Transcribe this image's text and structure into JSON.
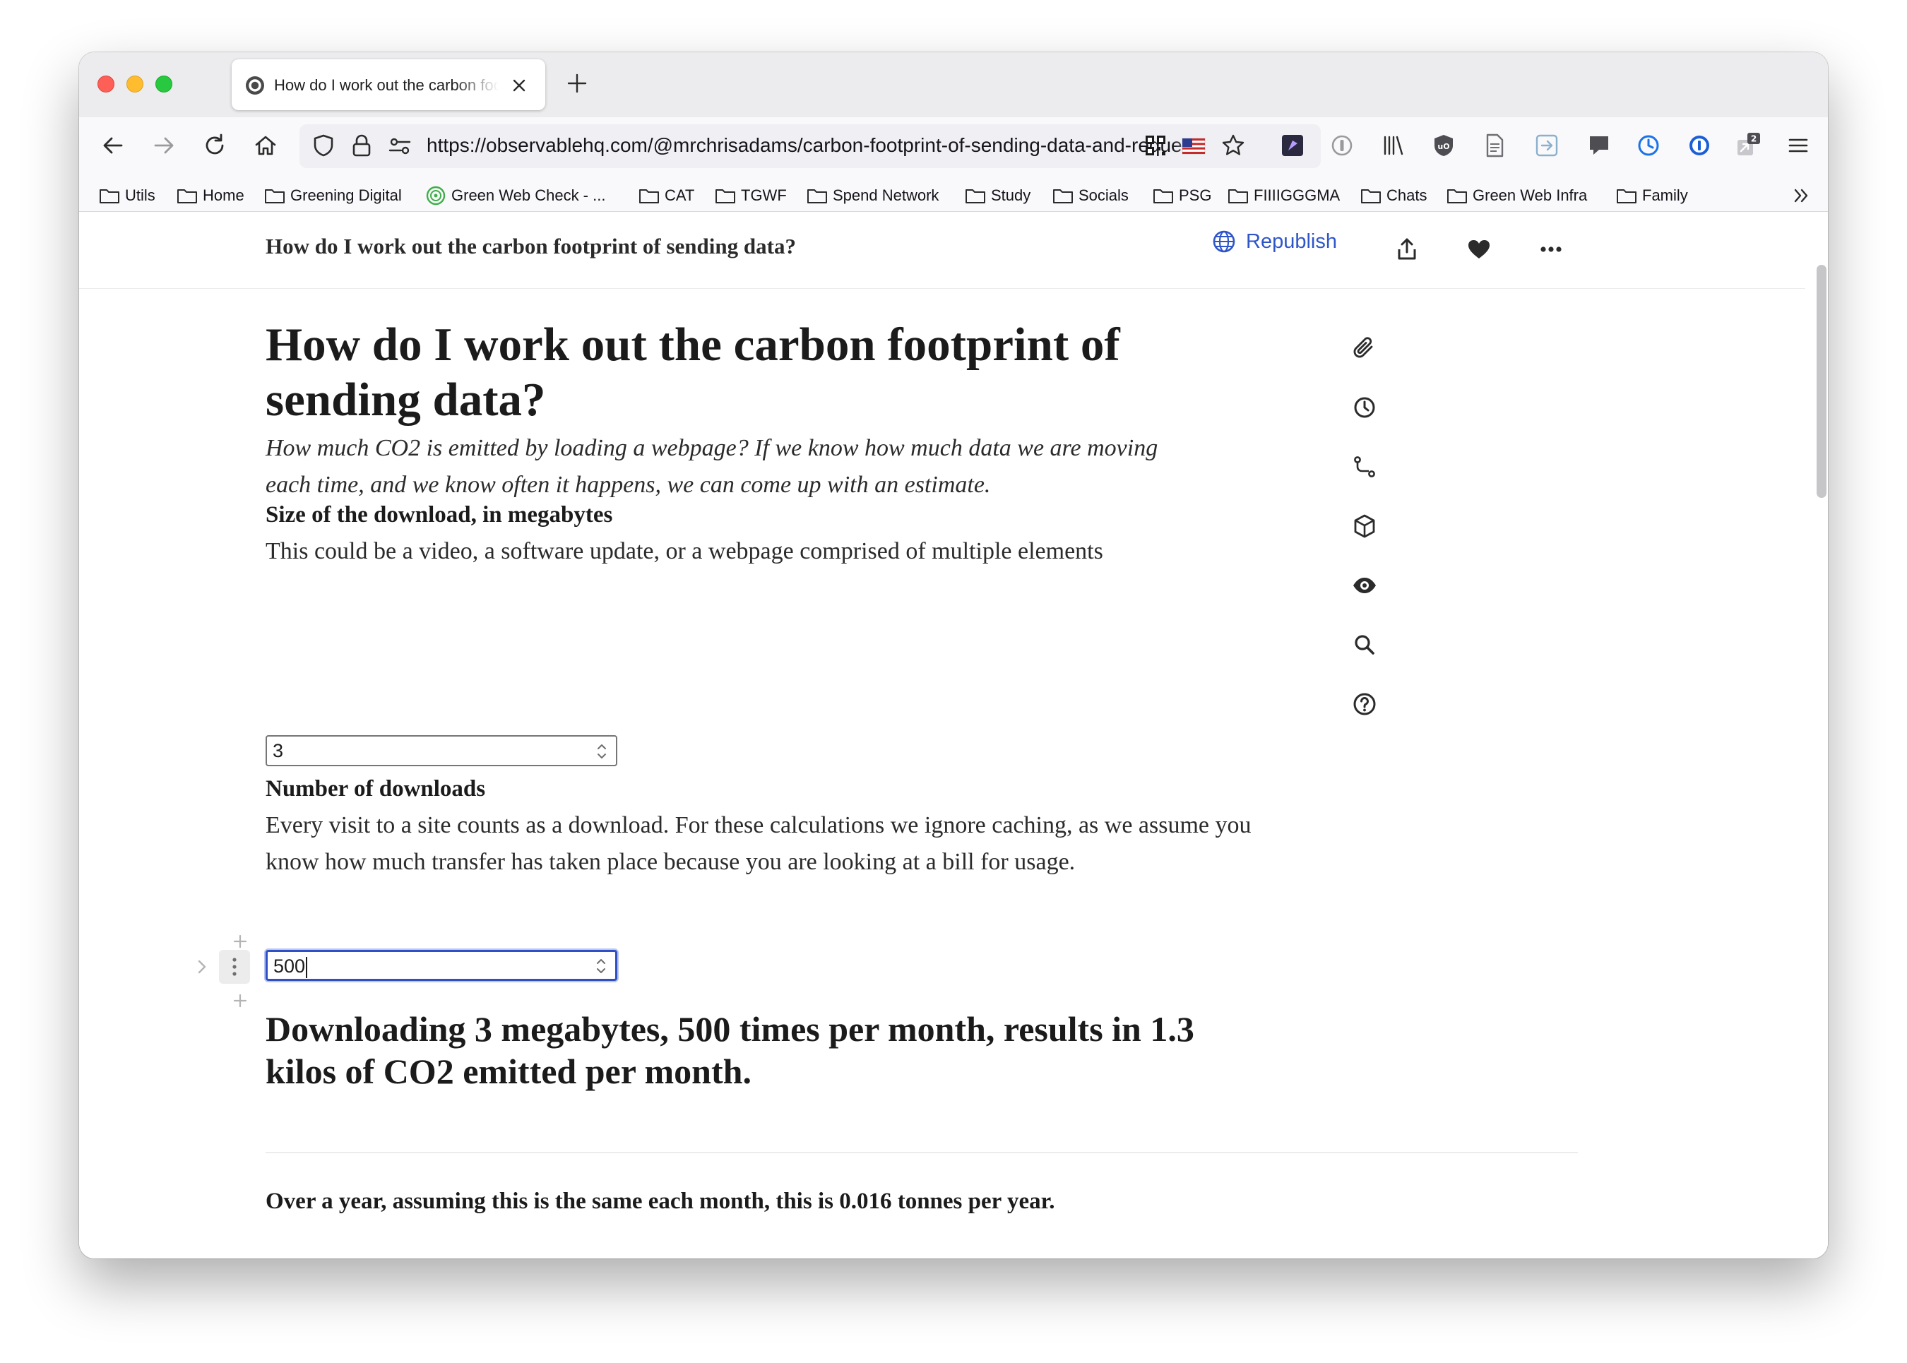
{
  "browser": {
    "tab": {
      "title": "How do I work out the carbon footprint of sending data?"
    },
    "url": "https://observablehq.com/@mrchrisadams/carbon-footprint-of-sending-data-and-requests",
    "toolbar_badge": "2",
    "icons": {
      "back": "arrow-left-icon",
      "forward": "arrow-right-icon",
      "reload": "reload-icon",
      "home": "home-icon",
      "tracking": "shield-icon",
      "lock": "lock-icon",
      "permissions": "permissions-icon",
      "bookmark": "star-icon",
      "menu": "hamburger-icon"
    },
    "bookmarks": [
      {
        "label": "Utils",
        "icon": "folder-icon"
      },
      {
        "label": "Home",
        "icon": "folder-icon"
      },
      {
        "label": "Greening Digital",
        "icon": "folder-icon"
      },
      {
        "label": "Green Web Check - ...",
        "icon": "green-web-check-icon"
      },
      {
        "label": "CAT",
        "icon": "folder-icon"
      },
      {
        "label": "TGWF",
        "icon": "folder-icon"
      },
      {
        "label": "Spend Network",
        "icon": "folder-icon"
      },
      {
        "label": "Study",
        "icon": "folder-icon"
      },
      {
        "label": "Socials",
        "icon": "folder-icon"
      },
      {
        "label": "PSG",
        "icon": "folder-icon"
      },
      {
        "label": "FIIIIGGGMA",
        "icon": "folder-icon"
      },
      {
        "label": "Chats",
        "icon": "folder-icon"
      },
      {
        "label": "Green Web Infra",
        "icon": "folder-icon"
      },
      {
        "label": "Family",
        "icon": "folder-icon"
      }
    ]
  },
  "notebook": {
    "header_title": "How do I work out the carbon footprint of sending data?",
    "republish_label": "Republish",
    "title": "How do I work out the carbon footprint of sending data?",
    "intro": "How much CO2 is emitted by loading a webpage? If we know how much data we are moving each time, and we know often it happens, we can come up with an estimate.",
    "download_size": {
      "label": "Size of the download, in megabytes",
      "description": "This could be a video, a software update, or a webpage comprised of multiple elements",
      "value": "3"
    },
    "downloads": {
      "label": "Number of downloads",
      "description": "Every visit to a site counts as a download. For these calculations we ignore caching, as we assume you know how much transfer has taken place because you are looking at a bill for usage.",
      "value": "500"
    },
    "result_text": "Downloading 3 megabytes, 500 times per month, results in 1.3 kilos of CO2 emitted per month.",
    "yearly_text": "Over a year, assuming this is the same each month, this is 0.016 tonnes per year.",
    "sidebar_icons": [
      "paperclip-icon",
      "history-icon",
      "dependency-icon",
      "package-icon",
      "visibility-icon",
      "search-icon",
      "help-icon"
    ],
    "accent_color": "#2f56c9"
  }
}
